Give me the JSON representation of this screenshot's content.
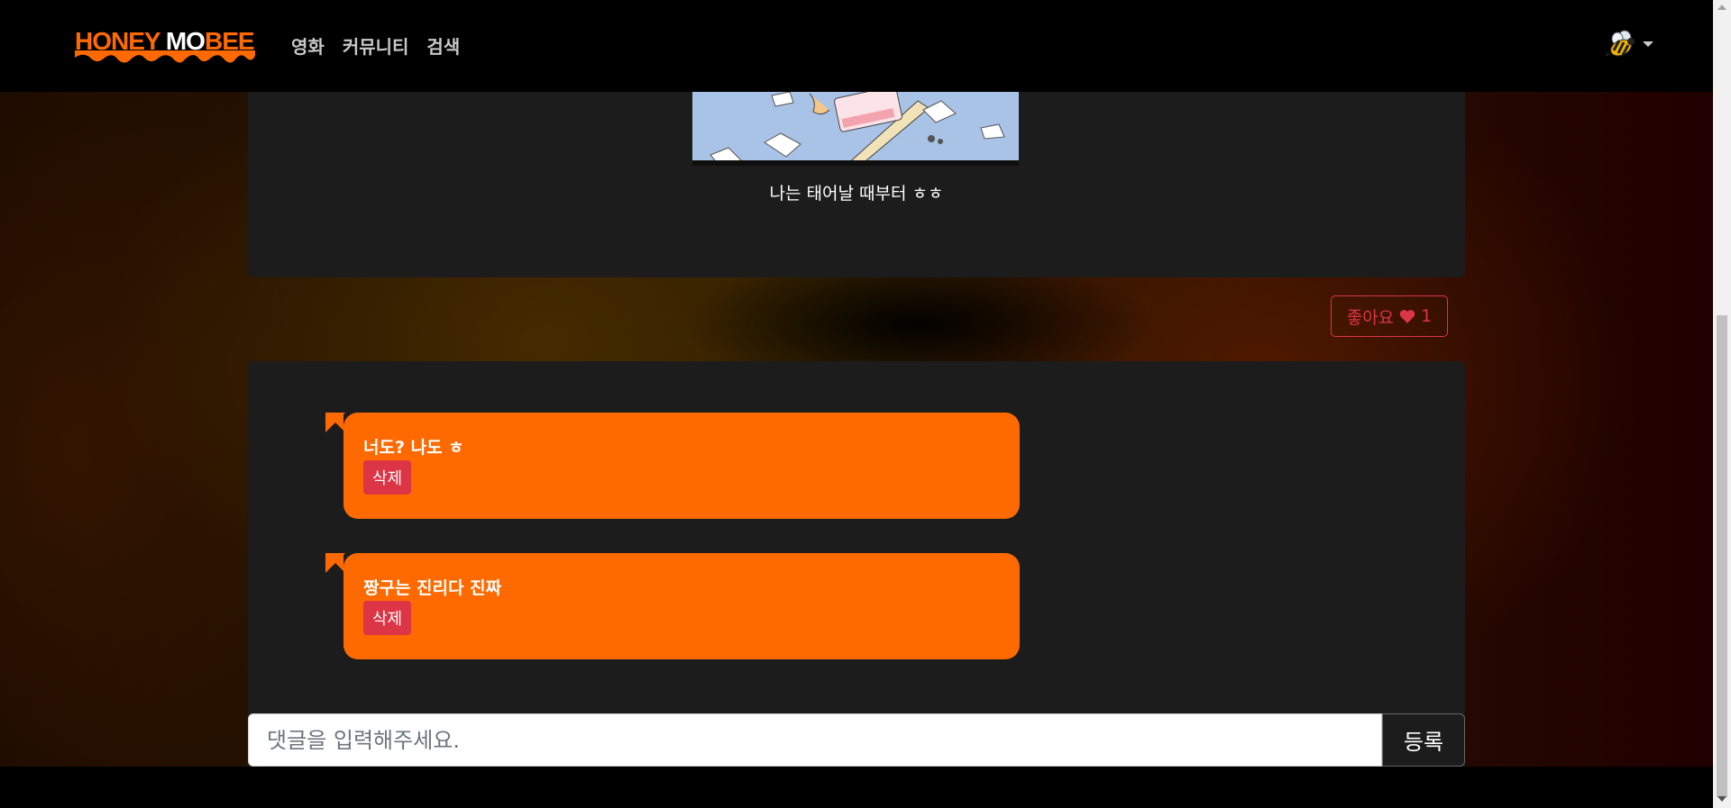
{
  "navbar": {
    "logo_part1": "HONEY ",
    "logo_part2": "MO",
    "logo_part3": "BEE",
    "links": [
      "영화",
      "커뮤니티",
      "검색"
    ],
    "user_icon": "bee-icon"
  },
  "post": {
    "caption": "나는 태어날 때부터 ㅎㅎ"
  },
  "like": {
    "label": "좋아요",
    "icon": "heart-icon",
    "count": "1"
  },
  "comments": [
    {
      "text": "너도? 나도 ㅎ",
      "delete_label": "삭제"
    },
    {
      "text": "짱구는 진리다 진짜",
      "delete_label": "삭제"
    }
  ],
  "comment_form": {
    "placeholder": "댓글을 입력해주세요.",
    "submit_label": "등록"
  },
  "colors": {
    "accent": "#ff6a00",
    "danger": "#dc3545",
    "card": "#1c1c1c"
  }
}
